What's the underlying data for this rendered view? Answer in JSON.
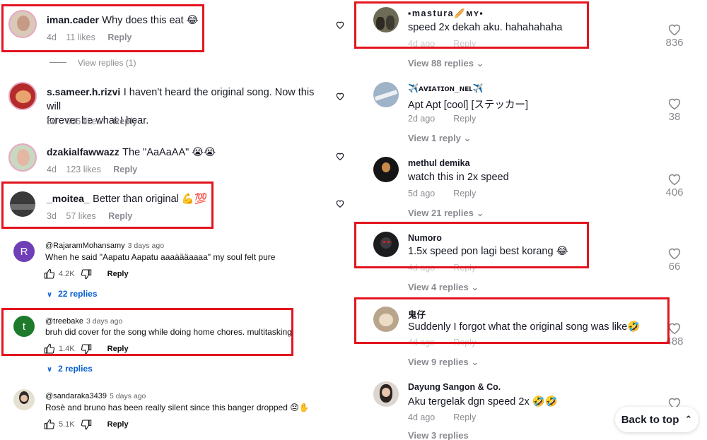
{
  "left": {
    "tt_comments": [
      {
        "user": "iman.cader",
        "text": "Why does this eat 😂",
        "date": "4d",
        "likes": "11 likes",
        "reply": "Reply",
        "view_replies": "View replies (1)"
      },
      {
        "user": "s.sameer.h.rizvi",
        "text": "I haven't heard the original song. Now this will",
        "text2": "forever be what I hear.",
        "date": "5d",
        "likes": "505 likes",
        "reply": "Reply"
      },
      {
        "user": "dzakialfawwazz",
        "text": "The \"AaAaAA\" 😭😭",
        "date": "4d",
        "likes": "123 likes",
        "reply": "Reply"
      },
      {
        "user": "_moitea_",
        "text": "Better than original 💪💯",
        "date": "3d",
        "likes": "57 likes",
        "reply": "Reply"
      }
    ],
    "yt_comments": [
      {
        "user": "@RajaramMohansamy",
        "date": "3 days ago",
        "text": "When he said \"Aapatu Aapatu aaaàääaaaa\" my soul felt pure",
        "likes": "4.2K",
        "reply": "Reply",
        "replies": "22 replies",
        "avatar_letter": "R"
      },
      {
        "user": "@treebake",
        "date": "3 days ago",
        "text": "bruh did cover for the song while doing home chores. multitasking",
        "likes": "1.4K",
        "reply": "Reply",
        "replies": "2 replies",
        "avatar_letter": "t"
      },
      {
        "user": "@sandaraka3439",
        "date": "5 days ago",
        "text": "Rosè and bruno has been really silent since this banger dropped 😔✋",
        "likes": "5.1K",
        "reply": "Reply"
      }
    ]
  },
  "right": {
    "comments": [
      {
        "user": "▪mastura🥖ᴍʏ▪",
        "text": "speed 2x dekah aku. hahahahaha",
        "date": "4d ago",
        "reply": "Reply",
        "view": "View 88 replies",
        "likes": "836"
      },
      {
        "user": "✈️ᴀᴠɪᴀᴛɪᴏɴ_ɴᴇʟ✈️",
        "text": "Apt Apt [cool] [ステッカー]",
        "date": "2d ago",
        "reply": "Reply",
        "view": "View 1 reply",
        "likes": "38"
      },
      {
        "user": "methul demika",
        "text": "watch this in 2x speed",
        "date": "5d ago",
        "reply": "Reply",
        "view": "View 21 replies",
        "likes": "406"
      },
      {
        "user": "Numoro",
        "text": "1.5x speed pon lagi best korang 😂",
        "date": "4d ago",
        "reply": "Reply",
        "view": "View 4 replies",
        "likes": "66"
      },
      {
        "user": "鬼仔",
        "text": "Suddenly I forgot what the original song was like🤣",
        "date": "4d ago",
        "reply": "Reply",
        "view": "View 9 replies",
        "likes": "488"
      },
      {
        "user": "Dayung Sangon & Co.",
        "text": "Aku tergelak dgn speed 2x 🤣🤣",
        "date": "4d ago",
        "reply": "Reply",
        "view": "View 3 replies",
        "likes": ""
      }
    ],
    "back_to_top": "Back to top"
  },
  "colors": {
    "highlight": "#e3141e",
    "yt_link": "#065fd4",
    "muted": "#8a8b91"
  }
}
